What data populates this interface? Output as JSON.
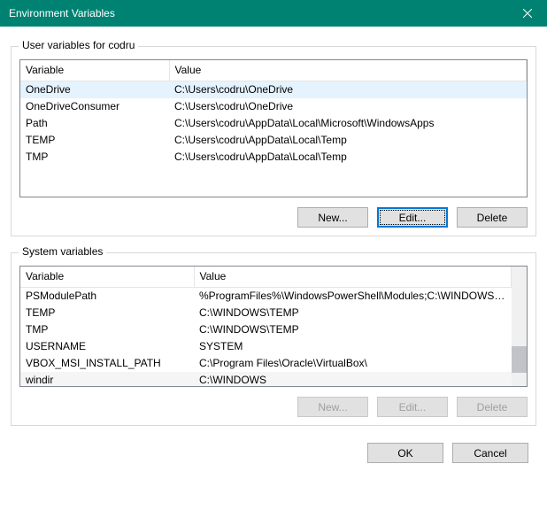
{
  "window": {
    "title": "Environment Variables"
  },
  "user_section": {
    "legend": "User variables for codru",
    "headers": {
      "variable": "Variable",
      "value": "Value"
    },
    "rows": [
      {
        "variable": "OneDrive",
        "value": "C:\\Users\\codru\\OneDrive"
      },
      {
        "variable": "OneDriveConsumer",
        "value": "C:\\Users\\codru\\OneDrive"
      },
      {
        "variable": "Path",
        "value": "C:\\Users\\codru\\AppData\\Local\\Microsoft\\WindowsApps"
      },
      {
        "variable": "TEMP",
        "value": "C:\\Users\\codru\\AppData\\Local\\Temp"
      },
      {
        "variable": "TMP",
        "value": "C:\\Users\\codru\\AppData\\Local\\Temp"
      }
    ],
    "buttons": {
      "new": "New...",
      "edit": "Edit...",
      "delete": "Delete"
    }
  },
  "system_section": {
    "legend": "System variables",
    "headers": {
      "variable": "Variable",
      "value": "Value"
    },
    "rows": [
      {
        "variable": "PSModulePath",
        "value": "%ProgramFiles%\\WindowsPowerShell\\Modules;C:\\WINDOWS\\syst..."
      },
      {
        "variable": "TEMP",
        "value": "C:\\WINDOWS\\TEMP"
      },
      {
        "variable": "TMP",
        "value": "C:\\WINDOWS\\TEMP"
      },
      {
        "variable": "USERNAME",
        "value": "SYSTEM"
      },
      {
        "variable": "VBOX_MSI_INSTALL_PATH",
        "value": "C:\\Program Files\\Oracle\\VirtualBox\\"
      },
      {
        "variable": "windir",
        "value": "C:\\WINDOWS"
      }
    ],
    "buttons": {
      "new": "New...",
      "edit": "Edit...",
      "delete": "Delete"
    }
  },
  "dialog_buttons": {
    "ok": "OK",
    "cancel": "Cancel"
  },
  "chart_data": {
    "type": "table",
    "tables": [
      {
        "name": "User variables for codru",
        "columns": [
          "Variable",
          "Value"
        ],
        "rows": [
          [
            "OneDrive",
            "C:\\Users\\codru\\OneDrive"
          ],
          [
            "OneDriveConsumer",
            "C:\\Users\\codru\\OneDrive"
          ],
          [
            "Path",
            "C:\\Users\\codru\\AppData\\Local\\Microsoft\\WindowsApps"
          ],
          [
            "TEMP",
            "C:\\Users\\codru\\AppData\\Local\\Temp"
          ],
          [
            "TMP",
            "C:\\Users\\codru\\AppData\\Local\\Temp"
          ]
        ],
        "selected_row_index": 0
      },
      {
        "name": "System variables",
        "columns": [
          "Variable",
          "Value"
        ],
        "rows": [
          [
            "PSModulePath",
            "%ProgramFiles%\\WindowsPowerShell\\Modules;C:\\WINDOWS\\syst..."
          ],
          [
            "TEMP",
            "C:\\WINDOWS\\TEMP"
          ],
          [
            "TMP",
            "C:\\WINDOWS\\TEMP"
          ],
          [
            "USERNAME",
            "SYSTEM"
          ],
          [
            "VBOX_MSI_INSTALL_PATH",
            "C:\\Program Files\\Oracle\\VirtualBox\\"
          ],
          [
            "windir",
            "C:\\WINDOWS"
          ]
        ],
        "selected_row_index": 5
      }
    ]
  }
}
